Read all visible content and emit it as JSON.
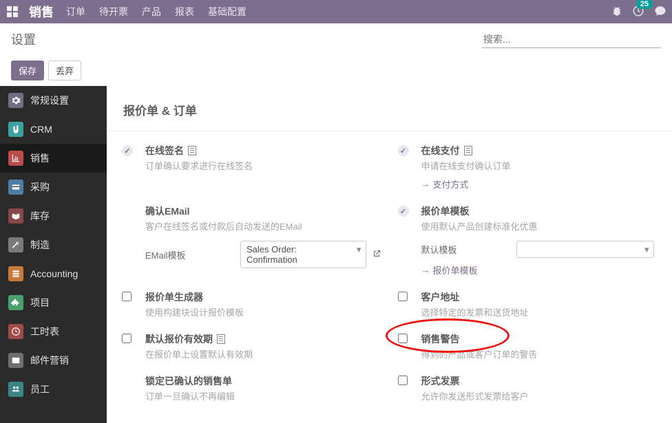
{
  "navbar": {
    "brand": "销售",
    "menu": [
      "订单",
      "待开票",
      "产品",
      "报表",
      "基础配置"
    ],
    "badge": "25"
  },
  "control": {
    "title": "设置",
    "search_placeholder": "搜索...",
    "save": "保存",
    "discard": "丢弃"
  },
  "sidebar": {
    "items": [
      {
        "label": "常规设置",
        "color": "#6f6f82",
        "icon": "gear"
      },
      {
        "label": "CRM",
        "color": "#3aa3a0",
        "icon": "hand"
      },
      {
        "label": "销售",
        "color": "#b94d4d",
        "icon": "chart"
      },
      {
        "label": "采购",
        "color": "#4d7fa6",
        "icon": "card"
      },
      {
        "label": "库存",
        "color": "#8a4747",
        "icon": "box"
      },
      {
        "label": "制造",
        "color": "#7a7a7a",
        "icon": "wrench"
      },
      {
        "label": "Accounting",
        "color": "#c77a3a",
        "icon": "acct"
      },
      {
        "label": "项目",
        "color": "#4aa06d",
        "icon": "puzzle"
      },
      {
        "label": "工时表",
        "color": "#a04a4a",
        "icon": "clock"
      },
      {
        "label": "邮件营销",
        "color": "#6f6f6f",
        "icon": "mail"
      },
      {
        "label": "员工",
        "color": "#3a8585",
        "icon": "people"
      }
    ],
    "active_index": 2
  },
  "section_title": "报价单 & 订单",
  "settings": {
    "online_sig": {
      "title": "在线签名",
      "desc": "订单确认要求进行在线签名",
      "checked": true,
      "doc": true
    },
    "online_pay": {
      "title": "在线支付",
      "desc": "申请在线支付确认订单",
      "checked": true,
      "doc": true,
      "link": "支付方式"
    },
    "confirm_email": {
      "title": "确认EMail",
      "desc": "客户在线签名或付款后自动发送的EMail",
      "checked": false,
      "field_label": "EMail模板",
      "field_value": "Sales Order: Confirmation"
    },
    "quote_tpl": {
      "title": "报价单模板",
      "desc": "使用默认产品创建标准化优惠",
      "checked": true,
      "field_label": "默认模板",
      "field_value": "",
      "link": "报价单模板"
    },
    "quote_builder": {
      "title": "报价单生成器",
      "desc": "使用构建块设计报价模板",
      "checked": false
    },
    "cust_addr": {
      "title": "客户地址",
      "desc": "选择特定的发票和送货地址",
      "checked": false
    },
    "default_valid": {
      "title": "默认报价有效期",
      "desc": "在报价单上设置默认有效期",
      "checked": false,
      "doc": true
    },
    "sale_warn": {
      "title": "销售警告",
      "desc": "得到的产品或客户订单的警告",
      "checked": false
    },
    "lock_conf": {
      "title": "锁定已确认的销售单",
      "desc": "订单一旦确认不再编辑",
      "checked": false
    },
    "proforma": {
      "title": "形式发票",
      "desc": "允许你发送形式发票给客户",
      "checked": false
    }
  }
}
